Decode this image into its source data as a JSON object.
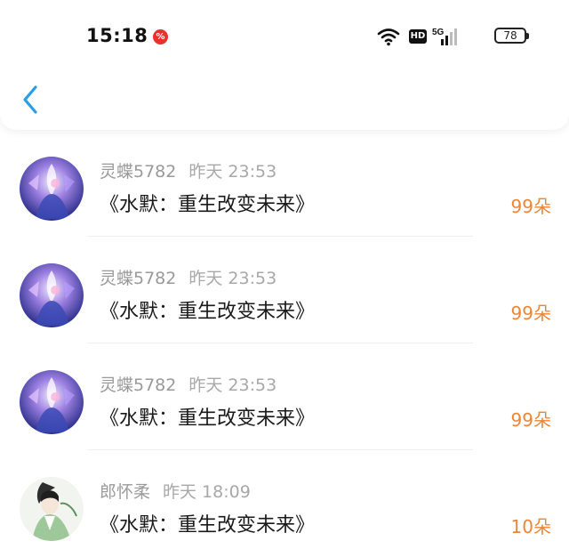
{
  "status_bar": {
    "time": "15:18",
    "network": "5G",
    "hd_badge": "HD",
    "battery": "78"
  },
  "gifts": [
    {
      "user": "灵蝶5782",
      "time": "昨天 23:53",
      "book": "《水默：重生改变未来》",
      "amount": "99朵",
      "avatar": "anime-blue-avatar"
    },
    {
      "user": "灵蝶5782",
      "time": "昨天 23:53",
      "book": "《水默：重生改变未来》",
      "amount": "99朵",
      "avatar": "anime-blue-avatar"
    },
    {
      "user": "灵蝶5782",
      "time": "昨天 23:53",
      "book": "《水默：重生改变未来》",
      "amount": "99朵",
      "avatar": "anime-blue-avatar"
    },
    {
      "user": "郎怀柔",
      "time": "昨天 18:09",
      "book": "《水默：重生改变未来》",
      "amount": "10朵",
      "avatar": "ink-painting-avatar"
    }
  ],
  "colors": {
    "accent": "#e8873c",
    "back_arrow": "#2a9de6"
  }
}
